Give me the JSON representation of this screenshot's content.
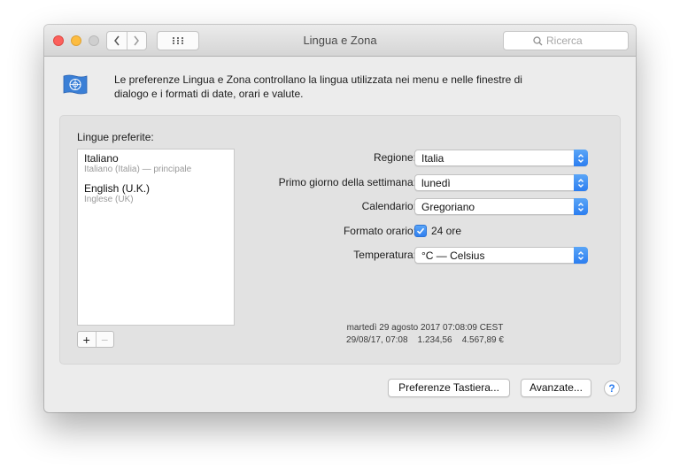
{
  "window": {
    "title": "Lingua e Zona",
    "search_placeholder": "Ricerca"
  },
  "intro": {
    "text": "Le preferenze Lingua e Zona controllano la lingua utilizzata nei menu e nelle finestre di dialogo e i formati di date, orari e valute."
  },
  "languages": {
    "label": "Lingue preferite:",
    "items": [
      {
        "name": "Italiano",
        "detail": "Italiano (Italia) — principale"
      },
      {
        "name": "English (U.K.)",
        "detail": "Inglese (UK)"
      }
    ],
    "add_label": "+",
    "remove_label": "−"
  },
  "settings": {
    "region": {
      "label": "Regione:",
      "value": "Italia"
    },
    "first_day": {
      "label": "Primo giorno della settimana:",
      "value": "lunedì"
    },
    "calendar": {
      "label": "Calendario:",
      "value": "Gregoriano"
    },
    "time_format": {
      "label": "Formato orario:",
      "checkbox_label": "24 ore",
      "checked": true
    },
    "temperature": {
      "label": "Temperatura:",
      "value": "°C — Celsius"
    }
  },
  "sample": {
    "line1": "martedì 29 agosto 2017 07:08:09 CEST",
    "line2": "29/08/17, 07:08    1.234,56    4.567,89 €"
  },
  "buttons": {
    "keyboard": "Preferenze Tastiera...",
    "advanced": "Avanzate...",
    "help": "?"
  },
  "colors": {
    "accent": "#2c7ef0",
    "close": "#fc605c",
    "minimize": "#fdbc40",
    "zoom_disabled": "#cfcfcf"
  },
  "icons": {
    "back": "chevron-left-icon",
    "forward": "chevron-right-icon",
    "show_all": "grid-icon",
    "search": "search-icon",
    "pane": "un-flag-icon"
  }
}
